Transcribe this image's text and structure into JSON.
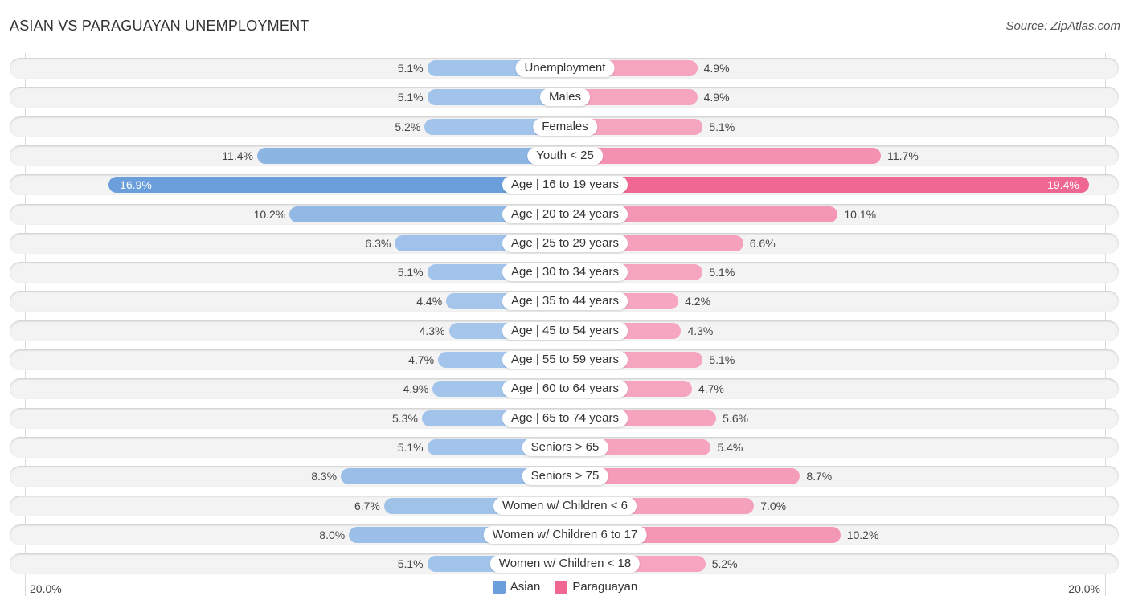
{
  "header": {
    "title": "ASIAN VS PARAGUAYAN UNEMPLOYMENT",
    "source": "Source: ZipAtlas.com"
  },
  "colors": {
    "asian": "#6a9fdb",
    "asian_light": "#a9c8ec",
    "paraguayan": "#f06892",
    "paraguayan_light": "#f6a9c2"
  },
  "chart_data": {
    "type": "bar",
    "orientation": "horizontal-diverging",
    "title": "ASIAN VS PARAGUAYAN UNEMPLOYMENT",
    "xlim": [
      -20,
      20
    ],
    "axis_labels": {
      "left": "20.0%",
      "right": "20.0%"
    },
    "legend": {
      "placement": "bottom-center",
      "entries": [
        "Asian",
        "Paraguayan"
      ]
    },
    "categories": [
      "Unemployment",
      "Males",
      "Females",
      "Youth < 25",
      "Age | 16 to 19 years",
      "Age | 20 to 24 years",
      "Age | 25 to 29 years",
      "Age | 30 to 34 years",
      "Age | 35 to 44 years",
      "Age | 45 to 54 years",
      "Age | 55 to 59 years",
      "Age | 60 to 64 years",
      "Age | 65 to 74 years",
      "Seniors > 65",
      "Seniors > 75",
      "Women w/ Children < 6",
      "Women w/ Children 6 to 17",
      "Women w/ Children < 18"
    ],
    "series": [
      {
        "name": "Asian",
        "side": "left",
        "values": [
          5.1,
          5.1,
          5.2,
          11.4,
          16.9,
          10.2,
          6.3,
          5.1,
          4.4,
          4.3,
          4.7,
          4.9,
          5.3,
          5.1,
          8.3,
          6.7,
          8.0,
          5.1
        ],
        "labels": [
          "5.1%",
          "5.1%",
          "5.2%",
          "11.4%",
          "16.9%",
          "10.2%",
          "6.3%",
          "5.1%",
          "4.4%",
          "4.3%",
          "4.7%",
          "4.9%",
          "5.3%",
          "5.1%",
          "8.3%",
          "6.7%",
          "8.0%",
          "5.1%"
        ]
      },
      {
        "name": "Paraguayan",
        "side": "right",
        "values": [
          4.9,
          4.9,
          5.1,
          11.7,
          19.4,
          10.1,
          6.6,
          5.1,
          4.2,
          4.3,
          5.1,
          4.7,
          5.6,
          5.4,
          8.7,
          7.0,
          10.2,
          5.2
        ],
        "labels": [
          "4.9%",
          "4.9%",
          "5.1%",
          "11.7%",
          "19.4%",
          "10.1%",
          "6.6%",
          "5.1%",
          "4.2%",
          "4.3%",
          "5.1%",
          "4.7%",
          "5.6%",
          "5.4%",
          "8.7%",
          "7.0%",
          "10.2%",
          "5.2%"
        ]
      }
    ]
  }
}
